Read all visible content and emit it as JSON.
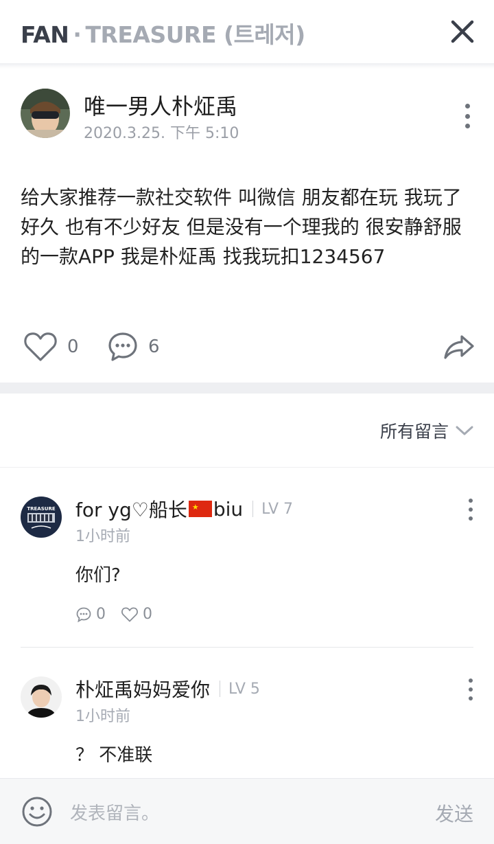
{
  "header": {
    "fan": "FAN",
    "dot": "·",
    "community": "TREASURE (트레저)"
  },
  "post": {
    "author": "唯一男人朴炡禹",
    "date": "2020.3.25. 下午 5:10",
    "body": "给大家推荐一款社交软件 叫微信 朋友都在玩 我玩了好久 也有不少好友 但是没有一个理我的 很安静舒服的一款APP 我是朴炡禹 找我玩扣1234567",
    "likes": "0",
    "comments": "6"
  },
  "sort": {
    "label": "所有留言"
  },
  "comments": [
    {
      "name_part1": "for yg♡船长",
      "name_part2": "biu",
      "level": "LV 7",
      "time": "1小时前",
      "text": "你们?",
      "reply_count": "0",
      "like_count": "0",
      "avatar_text": "TREASURE"
    },
    {
      "name": "朴炡禹妈妈爱你",
      "level": "LV 5",
      "time": "1小时前",
      "text": "？ 不准联"
    }
  ],
  "composer": {
    "placeholder": "发表留言。",
    "send_label": "发送"
  },
  "colors": {
    "accent_dark": "#3a3f4a",
    "muted": "#a5aab3",
    "divider_band": "#eeeff2"
  }
}
